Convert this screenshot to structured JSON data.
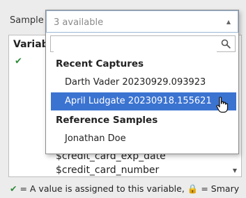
{
  "sample_label": "Sample",
  "panel": {
    "header": "Variab",
    "check_icon": "checkmark-icon",
    "variables": [
      "$credit_card_exp_date",
      "$credit_card_number"
    ]
  },
  "footer": {
    "check": "✔",
    "text1": " = A value is assigned to this variable, ",
    "lock": "🔒",
    "text2": " = Smary"
  },
  "dropdown": {
    "selected_text": "3 available",
    "search_placeholder": "",
    "groups": [
      {
        "title": "Recent Captures",
        "items": [
          "Darth Vader 20230929.093923",
          "April Ludgate 20230918.155621"
        ]
      },
      {
        "title": "Reference Samples",
        "items": [
          "Jonathan Doe"
        ]
      }
    ],
    "highlighted_item": "April Ludgate 20230918.155621"
  }
}
